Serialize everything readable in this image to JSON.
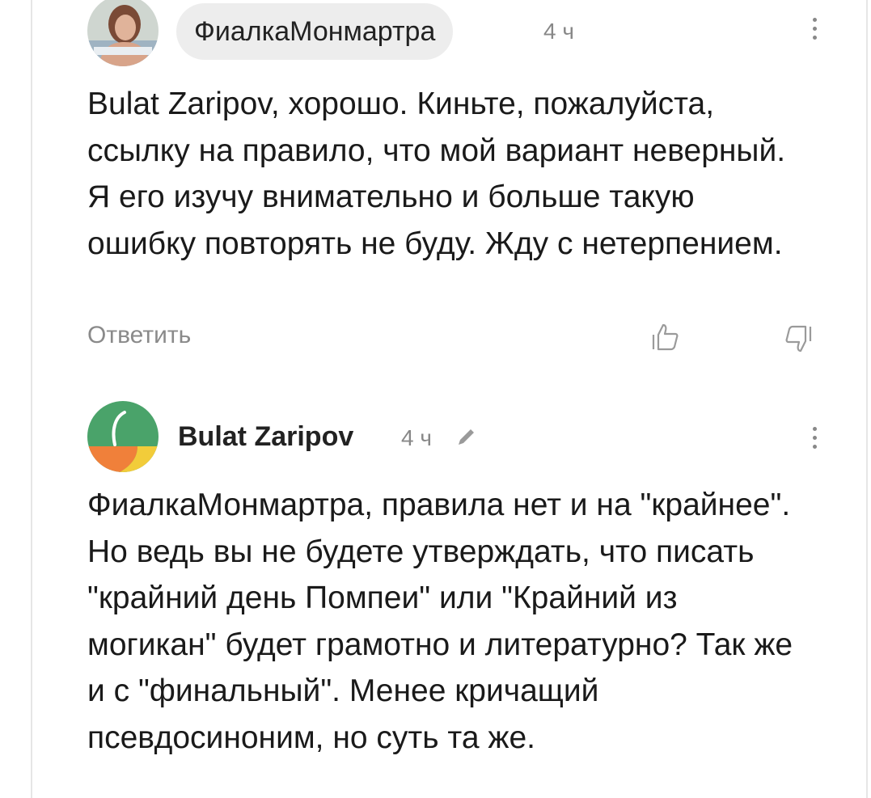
{
  "comments": [
    {
      "author": "ФиалкаМонмартра",
      "time": "4 ч",
      "text": "Bulat Zaripov, хорошо. Киньте, пожалуйста, ссылку на правило, что мой вариант неверный. Я его изучу внимательно и больше такую ошибку повторять не буду. Жду с нетерпением.",
      "reply_label": "Ответить"
    },
    {
      "author": "Bulat Zaripov",
      "time": "4 ч",
      "text": "ФиалкаМонмартра, правила нет и на \"крайнее\". Но ведь вы не будете утверждать, что писать \"крайний день Помпеи\" или \"Крайний из могикан\" будет грамотно и литературно? Так же и с \"финальный\". Менее кричащий псевдосиноним, но суть та же."
    }
  ],
  "icons": {
    "more": "kebab-menu-icon",
    "edit": "pencil-icon",
    "like": "thumbs-up-icon",
    "dislike": "thumbs-down-icon"
  },
  "colors": {
    "avatar_green": "#4aa36a",
    "avatar_orange": "#f0803a",
    "avatar_yellow": "#f2cc3a",
    "chip_bg": "#ededed",
    "muted_text": "#888888"
  }
}
